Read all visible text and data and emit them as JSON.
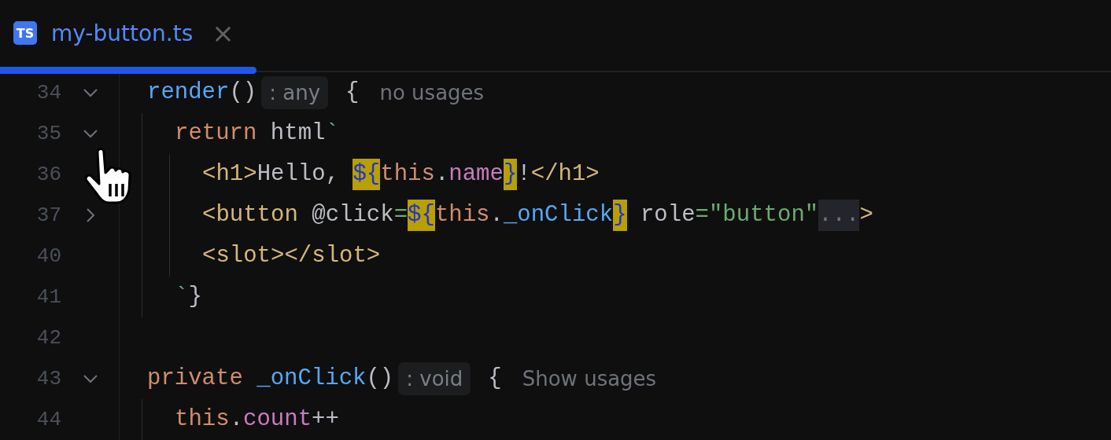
{
  "tabs": [
    {
      "icon_text": "TS",
      "label": "my-button.ts",
      "selected": true,
      "close_glyph": "×"
    }
  ],
  "lines": [
    {
      "number": "34",
      "foldable": true,
      "expanded": true,
      "tokens": [
        {
          "text": "render",
          "kind": "fn"
        },
        {
          "text": "()",
          "kind": "plain"
        },
        {
          "text": ": any",
          "kind": "hint"
        },
        {
          "text": "{",
          "kind": "brace"
        },
        {
          "text": "no usages",
          "kind": "usage"
        }
      ],
      "children": [
        {
          "number": "35",
          "foldable": true,
          "expanded": true,
          "tokens": [
            {
              "text": "return",
              "kind": "keyword"
            },
            {
              "text": " html",
              "kind": "plain"
            },
            {
              "text": "`",
              "kind": "string"
            }
          ],
          "children": [
            {
              "number": "36",
              "tokens": [
                {
                  "text": "<h1>",
                  "kind": "tag"
                },
                {
                  "text": "Hello, ",
                  "kind": "plain"
                },
                {
                  "text": "${",
                  "kind": "interp",
                  "highlighted": true
                },
                {
                  "text": "this",
                  "kind": "keyword"
                },
                {
                  "text": ".",
                  "kind": "plain"
                },
                {
                  "text": "name",
                  "kind": "field"
                },
                {
                  "text": "}",
                  "kind": "interp",
                  "highlighted": true
                },
                {
                  "text": "!",
                  "kind": "plain"
                },
                {
                  "text": "</h1>",
                  "kind": "tag"
                }
              ]
            },
            {
              "number": "37",
              "foldable": true,
              "expanded": false,
              "tokens": [
                {
                  "text": "<button",
                  "kind": "tag"
                },
                {
                  "text": " @click",
                  "kind": "plain"
                },
                {
                  "text": "=",
                  "kind": "string"
                },
                {
                  "text": "${",
                  "kind": "interp",
                  "highlighted": true
                },
                {
                  "text": "this",
                  "kind": "keyword"
                },
                {
                  "text": ".",
                  "kind": "plain"
                },
                {
                  "text": "_onClick",
                  "kind": "fn"
                },
                {
                  "text": "}",
                  "kind": "interp",
                  "highlighted": true
                },
                {
                  "text": " role",
                  "kind": "plain"
                },
                {
                  "text": "=\"button\"",
                  "kind": "string"
                },
                {
                  "text": "...",
                  "kind": "folded"
                },
                {
                  "text": ">",
                  "kind": "tag"
                }
              ]
            },
            {
              "number": "40",
              "tokens": [
                {
                  "text": "<slot></slot>",
                  "kind": "tag"
                }
              ]
            }
          ]
        },
        {
          "number": "41",
          "tokens": [
            {
              "text": "`",
              "kind": "string"
            },
            {
              "text": "}",
              "kind": "plain"
            }
          ]
        }
      ]
    },
    {
      "number": "42"
    },
    {
      "number": "43",
      "foldable": true,
      "expanded": true,
      "tokens": [
        {
          "text": "private ",
          "kind": "keyword"
        },
        {
          "text": "_onClick",
          "kind": "fn"
        },
        {
          "text": "()",
          "kind": "plain"
        },
        {
          "text": ": void",
          "kind": "hint"
        },
        {
          "text": "{",
          "kind": "brace"
        },
        {
          "text": "Show usages",
          "kind": "usage"
        }
      ],
      "children": [
        {
          "number": "44",
          "tokens": [
            {
              "text": "this",
              "kind": "keyword"
            },
            {
              "text": ".",
              "kind": "plain"
            },
            {
              "text": "count",
              "kind": "field"
            },
            {
              "text": "++",
              "kind": "plain"
            }
          ]
        }
      ]
    }
  ]
}
